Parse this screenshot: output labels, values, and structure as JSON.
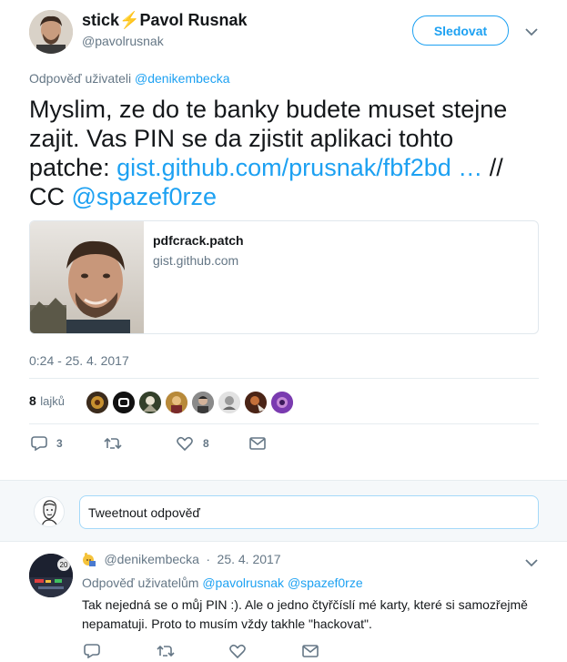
{
  "tweet": {
    "author_name": "stick⚡Pavol Rusnak",
    "author_handle": "@pavolrusnak",
    "follow_label": "Sledovat",
    "reply_to_prefix": "Odpověď uživateli",
    "reply_to_handle": "@denikembecka",
    "text_part1": "Myslim, ze do te banky budete muset stejne zajit. Vas PIN se da zjistit aplikaci tohto patche: ",
    "text_link": "gist.github.com/prusnak/fbf2bd …",
    "text_part2": " // CC ",
    "text_mention": "@spazef0rze",
    "card_title": "pdfcrack.patch",
    "card_domain": "gist.github.com",
    "timestamp": "0:24 - 25. 4. 2017",
    "likes_count": "8",
    "likes_label": "lajků",
    "reply_count": "3",
    "retweet_count": "",
    "like_count": "8"
  },
  "reply_box": {
    "placeholder": "Tweetnout odpověď"
  },
  "reply": {
    "handle": "@denikembecka",
    "separator": "·",
    "date": "25. 4. 2017",
    "reply_to_prefix": "Odpověď uživatelům",
    "reply_to_1": "@pavolrusnak",
    "reply_to_2": "@spazef0rze",
    "text": "Tak nejedná se o můj PIN :). Ale o jedno čtyřčíslí mé karty, které si samozřejmě nepamatuji. Proto to musím vždy takhle \"hackovat\"."
  },
  "icons": {
    "reply": "reply-icon",
    "retweet": "retweet-icon",
    "like": "heart-icon",
    "message": "envelope-icon",
    "more": "chevron-down-icon"
  },
  "colors": {
    "accent": "#1da1f2",
    "muted": "#657786",
    "text": "#14171a",
    "divider": "#e6ecf0",
    "reply_bg": "#f5f8fa"
  }
}
